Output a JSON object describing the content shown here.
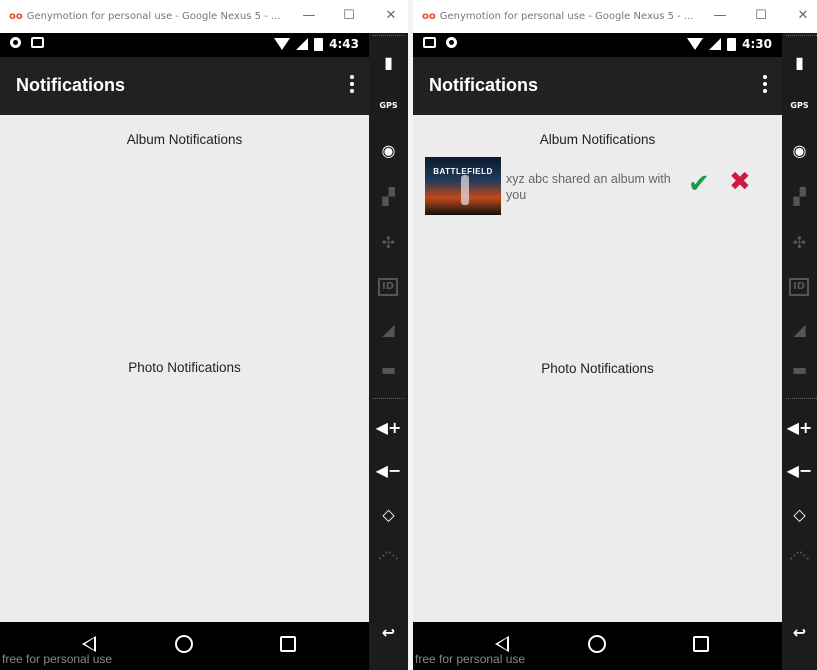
{
  "left": {
    "window_title": "Genymotion for personal use - Google Nexus 5 - ...",
    "window_logo": "oo",
    "status_time": "4:43",
    "toolbar_title": "Notifications",
    "album_section": "Album Notifications",
    "photo_section": "Photo Notifications",
    "watermark": "free for personal use"
  },
  "right": {
    "window_title": "Genymotion for personal use - Google Nexus 5 - ...",
    "window_logo": "oo",
    "status_time": "4:30",
    "toolbar_title": "Notifications",
    "album_section": "Album Notifications",
    "photo_section": "Photo Notifications",
    "watermark": "free for personal use",
    "notification": {
      "thumbnail_text": "BATTLEFIELD",
      "message": "xyz abc shared an album with you",
      "accept_icon": "check-icon",
      "decline_icon": "close-icon"
    }
  },
  "window_controls": {
    "minimize": "—",
    "maximize": "☐",
    "close": "✕"
  },
  "sidebar": {
    "gps_label": "GPS",
    "id_label": "ID",
    "volume_up": "◀+",
    "volume_down": "◀−",
    "icons": [
      "battery-icon",
      "gps-icon",
      "webcam-icon",
      "video-icon",
      "dpad-icon",
      "id-icon",
      "rss-icon",
      "sms-icon",
      "volume-up-icon",
      "volume-down-icon",
      "rotate-icon",
      "pixel-perfect-icon"
    ]
  },
  "colors": {
    "accept": "#1d9a52",
    "decline": "#d01843",
    "toolbar": "#212121",
    "background": "#ececec"
  }
}
